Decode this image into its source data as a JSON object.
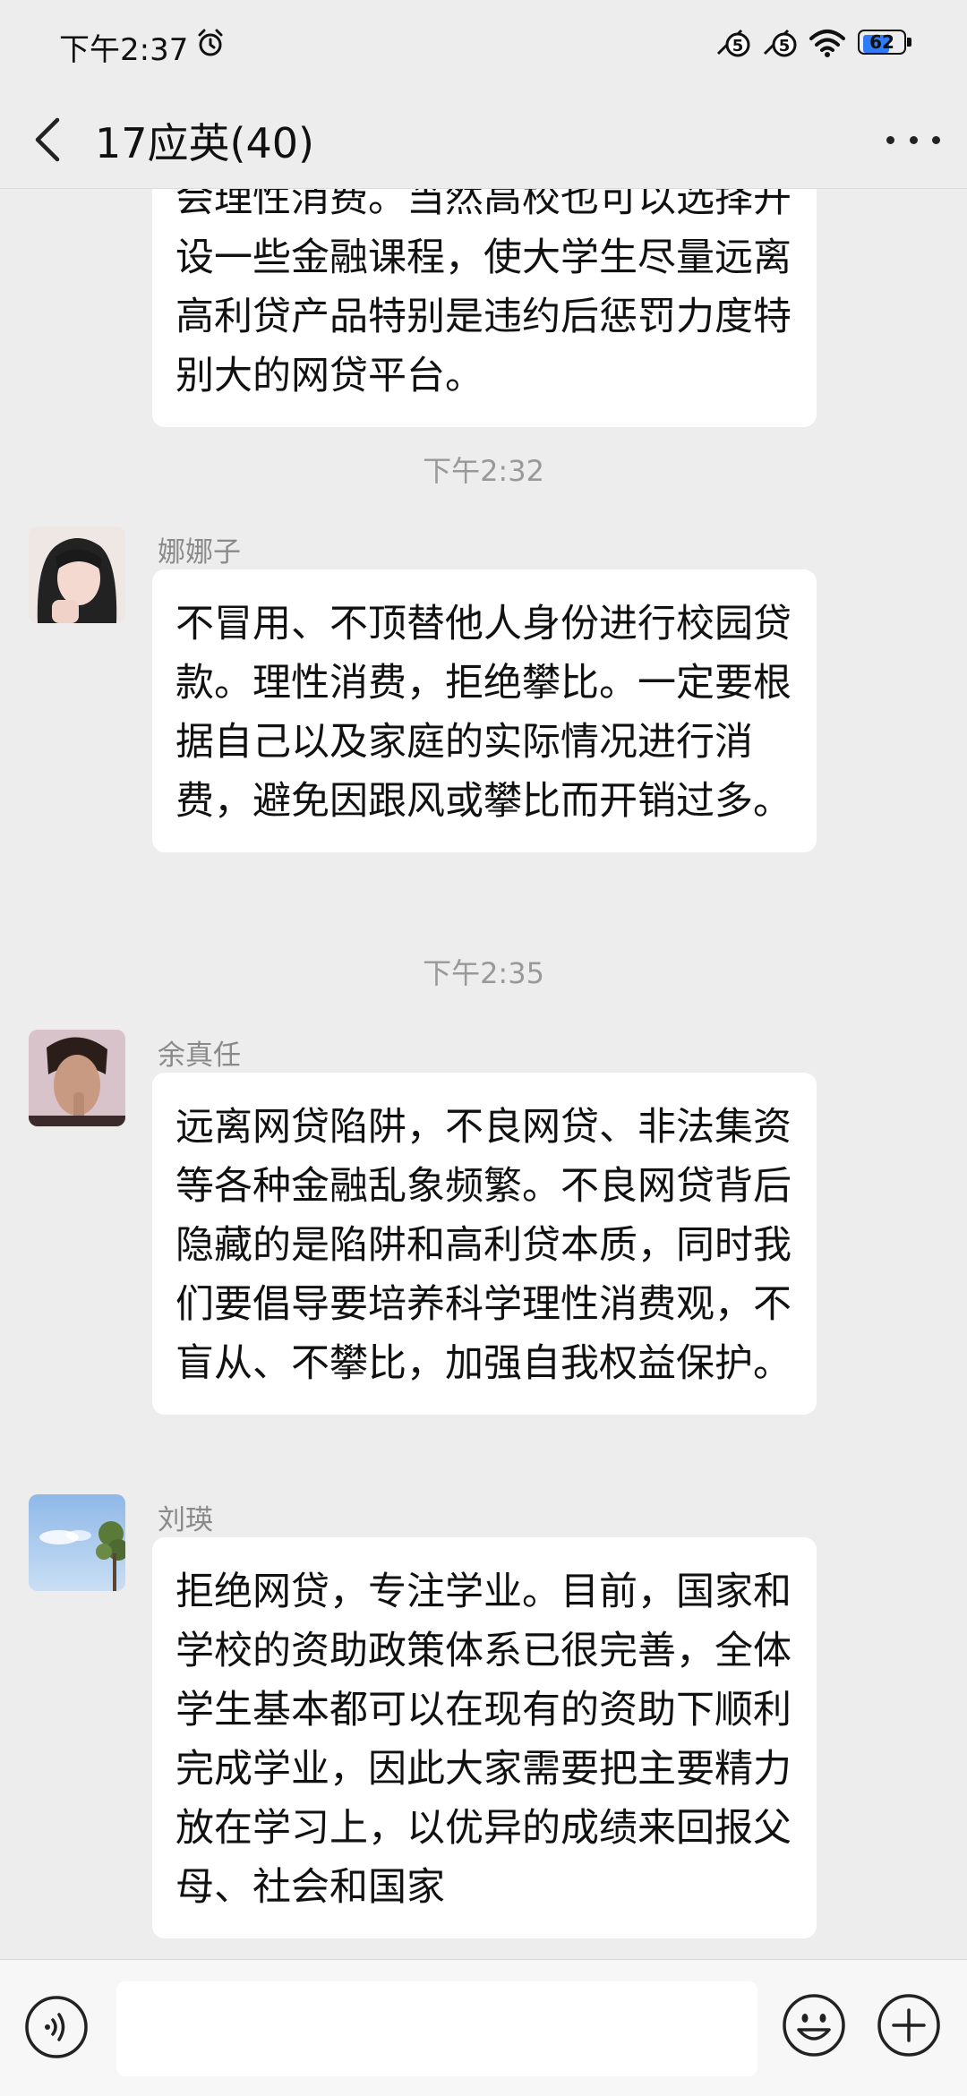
{
  "status_bar": {
    "time": "下午2:37",
    "sim1_label": "5",
    "sim2_label": "5",
    "battery_level": "62",
    "battery_fraction": 0.62
  },
  "header": {
    "title": "17应英(40)",
    "icons": [
      "back-arrow-icon",
      "mute-bell-icon",
      "ear-icon",
      "more-dots-icon"
    ]
  },
  "messages": [
    {
      "sender": "",
      "text": "会理性消费。当然高校也可以选择开设一些金融课程，使大学生尽量远离高利贷产品特别是违约后惩罚力度特别大的网贷平台。"
    },
    {
      "timestamp": "下午2:32"
    },
    {
      "sender": "娜娜子",
      "text": "不冒用、不顶替他人身份进行校园贷款。理性消费，拒绝攀比。一定要根据自己以及家庭的实际情况进行消费，避免因跟风或攀比而开销过多。"
    },
    {
      "timestamp": "下午2:35"
    },
    {
      "sender": "余真任",
      "text": "远离网贷陷阱，不良网贷、非法集资等各种金融乱象频繁。不良网贷背后隐藏的是陷阱和高利贷本质，同时我们要倡导要培养科学理性消费观，不盲从、不攀比，加强自我权益保护。"
    },
    {
      "sender": "刘瑛",
      "text": "拒绝网贷，专注学业。目前，国家和学校的资助政策体系已很完善，全体学生基本都可以在现有的资助下顺利完成学业，因此大家需要把主要精力放在学习上，以优异的成绩来回报父母、社会和国家"
    }
  ],
  "bottom_bar": {
    "input_value": "",
    "icons": [
      "voice-icon",
      "emoji-icon",
      "plus-icon"
    ]
  },
  "colors": {
    "background": "#ededed",
    "bubble": "#ffffff",
    "battery_accent": "#2f7cf6",
    "timestamp_text": "#999999"
  }
}
